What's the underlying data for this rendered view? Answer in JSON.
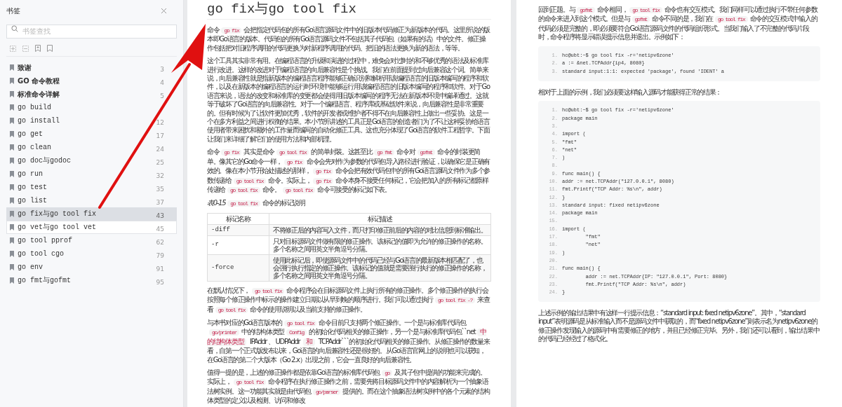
{
  "sidebar": {
    "title": "书签",
    "search": {
      "placeholder": "书签查找"
    },
    "items": [
      {
        "kind": "chapter",
        "label": "致谢",
        "page": "3",
        "selected": false,
        "hovered": false
      },
      {
        "kind": "chapter",
        "label": "GO 命令教程",
        "page": "4",
        "selected": false,
        "hovered": false
      },
      {
        "kind": "chapter",
        "label": "标准命令详解",
        "page": "5",
        "selected": false,
        "hovered": false
      },
      {
        "kind": "command",
        "label": "go build",
        "selected": false,
        "hovered": false
      },
      {
        "kind": "command",
        "label": "go install",
        "page": "12",
        "selected": false,
        "hovered": false
      },
      {
        "kind": "command",
        "label": "go get",
        "page": "17",
        "selected": false,
        "hovered": false
      },
      {
        "kind": "command",
        "label": "go clean",
        "page": "24",
        "selected": false,
        "hovered": false
      },
      {
        "kind": "command",
        "label": "go doc与godoc",
        "page": "25",
        "selected": false,
        "hovered": false
      },
      {
        "kind": "command",
        "label": "go run",
        "page": "32",
        "selected": false,
        "hovered": false
      },
      {
        "kind": "command",
        "label": "go test",
        "page": "35",
        "selected": false,
        "hovered": false
      },
      {
        "kind": "command",
        "label": "go list",
        "page": "37",
        "selected": false,
        "hovered": false
      },
      {
        "kind": "command",
        "label": "go fix与go tool fix",
        "page": "43",
        "selected": true,
        "hovered": false
      },
      {
        "kind": "command",
        "label": "go vet与go tool vet",
        "page": "45",
        "selected": false,
        "hovered": true
      },
      {
        "kind": "command",
        "label": "go tool pprof",
        "page": "62",
        "selected": false,
        "hovered": false
      },
      {
        "kind": "command",
        "label": "go tool cgo",
        "page": "79",
        "selected": false,
        "hovered": false
      },
      {
        "kind": "command",
        "label": "go env",
        "page": "91",
        "selected": false,
        "hovered": false
      },
      {
        "kind": "command",
        "label": "go fmt与gofmt",
        "page": "95",
        "selected": false,
        "hovered": false
      }
    ]
  },
  "left_page": {
    "title": "go fix与go tool fix",
    "blocks": [
      {
        "kind": "paragraph",
        "segments": [
          {
            "kind": "text",
            "text": "命令"
          },
          {
            "kind": "code",
            "text": "go fix"
          },
          {
            "kind": "text",
            "text": "会把指定代码包的所有Go语言源码文件中的旧版本代码修正为新版本的代码。这里所说的版本即Go语言的版本。代码包的所有Go语言源码文件不包括其子代码包（如果有的话）中的文件。修正操作包括把对旧程序调用的代码更换为对新程序调用的代码、把旧的语法更换为新的语法，等等。"
          }
        ]
      },
      {
        "kind": "paragraph",
        "segments": [
          {
            "kind": "text",
            "text": "这个工具其实非常有用。在编程语言的升级和演进的过程中，难免会对过时的和不够优秀的语法及标准库进行改进。这样的改进对于编程语言的向后兼容性是个挑战。我们在前面提到过向后兼容这个词。简单来说，向后兼容性就是指新版本的编程语言程序能够正确识别和解析用该编程语言的旧版本编写的程序和软件，以及在新版本的编程语言的运行时环境中能够运行用该编程语言的旧版本编写的程序和软件。对于Go语言来说，语法的改变和标准库的变更都会使得用旧版本编写的程序无法在新版本环境中编译通过。这就等于破坏了Go语言的向后兼容性。对于一个编程语言、程序库或基础软件来说，向后兼容性是非常重要的。但有时候为了让软件更加优秀，软件的开发者或维护者不得不在向后兼容性上做出一些妥协。这是一个在多方利益之间进行权衡的结果。本小节所讲述的工具正是Go语言的创造者们为了不让这种妥协给语言使用者带来困扰和额外的工作量而编写的自动化修正工具。这也充分体现了Go语言的软件工程哲学。下面让我们来详细了解它们的使用方法和内部机理。"
          }
        ]
      },
      {
        "kind": "paragraph",
        "segments": [
          {
            "kind": "text",
            "text": "命令"
          },
          {
            "kind": "code",
            "text": "go fix"
          },
          {
            "kind": "text",
            "text": "其实是命令"
          },
          {
            "kind": "code",
            "text": "go tool fix"
          },
          {
            "kind": "text",
            "text": "的简单封装。这甚至比"
          },
          {
            "kind": "code",
            "text": "go fmt"
          },
          {
            "kind": "text",
            "text": "命令对"
          },
          {
            "kind": "code",
            "text": "gofmt"
          },
          {
            "kind": "text",
            "text": "命令的封装更简单。像其它的Go命令一样，"
          },
          {
            "kind": "code",
            "text": "go fix"
          },
          {
            "kind": "text",
            "text": "命令会先对作为参数的代码包导入路径进行验证，以确保它是正确有效的。像在本小节开始处描述的那样，"
          },
          {
            "kind": "code",
            "text": "go fix"
          },
          {
            "kind": "text",
            "text": "命令会把有效代码包中的所有Go语言源码文件作为多个参数传递给"
          },
          {
            "kind": "code",
            "text": "go tool fix"
          },
          {
            "kind": "text",
            "text": "命令。实际上，"
          },
          {
            "kind": "code",
            "text": "go fix"
          },
          {
            "kind": "text",
            "text": "命令本身不接受任何标记，它会把加入的所有标记都原样传递给"
          },
          {
            "kind": "code",
            "text": "go tool fix"
          },
          {
            "kind": "text",
            "text": "命令。"
          },
          {
            "kind": "code",
            "text": "go tool fix"
          },
          {
            "kind": "text",
            "text": "命令可接受的标记如下表。"
          }
        ]
      },
      {
        "kind": "caption",
        "segments": [
          {
            "kind": "label",
            "text": "表0-15"
          },
          {
            "kind": "code",
            "text": "go tool fix"
          },
          {
            "kind": "text",
            "text": "命令的标记说明"
          }
        ]
      },
      {
        "kind": "table",
        "columns": [
          "标记名称",
          "标记描述"
        ],
        "rows": [
          [
            "-diff",
            "不将修正后的内容写入文件，而只打印修正前后的内容的对比信息到标准输出。"
          ],
          [
            "-r",
            "只对目标源码文件做有限的修正操作。该标记的值即为允许的修正操作的名称。多个名称之间用英文半角逗号分隔。"
          ],
          [
            "-force",
            "使用此标记后，即使源码文件中的代码已经与Go语言的最新版本相匹配了，也会强行执行指定的修正操作。该标记的值就是需要强行执行的修正操作的名称，多个名称之间用英文半角逗号分隔。"
          ]
        ]
      },
      {
        "kind": "paragraph",
        "segments": [
          {
            "kind": "text",
            "text": "在默认情况下，"
          },
          {
            "kind": "code",
            "text": "go tool fix"
          },
          {
            "kind": "text",
            "text": "命令程序会在目标源码文件上执行所有的修正操作。多个修正操作的执行会按照每个修正操作中标示的操作建立日期以从早到晚的顺序进行。我们可以通过执行"
          },
          {
            "kind": "code",
            "text": "go tool fix -?"
          },
          {
            "kind": "text",
            "text": "来查看"
          },
          {
            "kind": "code",
            "text": "go tool fix"
          },
          {
            "kind": "text",
            "text": "命令的使用说明以及当前支持的修正操作。"
          }
        ]
      },
      {
        "kind": "paragraph",
        "segments": [
          {
            "kind": "text",
            "text": "与本书对应的Go语言版本的"
          },
          {
            "kind": "code",
            "text": "go tool fix"
          },
          {
            "kind": "text",
            "text": "命令目前只支持两个修正操作。一个是与标准库代码包"
          },
          {
            "kind": "code",
            "text": "go/printer"
          },
          {
            "kind": "text",
            "text": "中的结构体类型"
          },
          {
            "kind": "code",
            "text": "Config"
          },
          {
            "kind": "text",
            "text": "的初始化代码相关的修正操作，另一个是与标准库代码包``net"
          },
          {
            "kind": "code",
            "text": "中的结构体类型"
          },
          {
            "kind": "text",
            "text": " IPAddr 、 UDPAddr "
          },
          {
            "kind": "code",
            "text": "和"
          },
          {
            "kind": "text",
            "text": " TCPAddr```的初始化代码相关的修正操作。从修正操作的数量来看，自第一个正式版发布以来，Go语言的向后兼容性还是很好的。从Go语言官网上的说明也可以获知，在Go语言的第二个大版本（Go 2.x）出现之前，它会一直良好的向后兼容性。"
          }
        ]
      },
      {
        "kind": "paragraph",
        "segments": [
          {
            "kind": "text",
            "text": "值得一提的是，上述的修正操作都是依靠Go语言的标准库代码包"
          },
          {
            "kind": "code",
            "text": "go"
          },
          {
            "kind": "text",
            "text": "及其子包中提供的功能来完成的。实际上，"
          },
          {
            "kind": "code",
            "text": "go tool fix"
          },
          {
            "kind": "text",
            "text": "命令程序在执行修正操作之前，需要先将目标源码文件中的内容解析为一个抽象语法树实例。这一功能其实就是由代码包"
          },
          {
            "kind": "code",
            "text": "go/parser"
          },
          {
            "kind": "text",
            "text": "提供的。而在这个抽象语法树实例中的各个元素的结构体类型的定义以及检测、访问和修改"
          }
        ]
      }
    ]
  },
  "right_page": {
    "blocks": [
      {
        "kind": "paragraph",
        "segments": [
          {
            "kind": "text",
            "text": "回到正题。与"
          },
          {
            "kind": "code",
            "text": "gofmt"
          },
          {
            "kind": "text",
            "text": "命令相同，"
          },
          {
            "kind": "code",
            "text": "go tool fix"
          },
          {
            "kind": "text",
            "text": "命令也有交互模式。我们同样可以通过执行不带任何参数的命令来进入到这个模式。但是与"
          },
          {
            "kind": "code",
            "text": "gofmt"
          },
          {
            "kind": "text",
            "text": "命令不同的是，我们在"
          },
          {
            "kind": "code",
            "text": "go tool fix"
          },
          {
            "kind": "text",
            "text": "命令的交互模式中输入的代码必须是完整的，即必须要符合Go语言源码文件的代码组织形式。当我们输入了不完整的代码片段时，命令程序将显示错误提示信息并退出。示例如下："
          }
        ]
      },
      {
        "kind": "code",
        "lines": [
          {
            "n": "1.",
            "code": "hc@ubt:~$ go tool fix -r='netipv6zone'"
          },
          {
            "n": "2.",
            "code": "a := &net.TCPAddr{ip4, 8080}"
          },
          {
            "n": "3.",
            "code": "standard input:1:1: expected 'package', found 'IDENT' a"
          }
        ]
      },
      {
        "kind": "paragraph",
        "segments": [
          {
            "kind": "text",
            "text": "相对于上面的示例，我们必须要这样输入源码才能获得正常的结果："
          }
        ]
      },
      {
        "kind": "code",
        "lines": [
          {
            "n": "1.",
            "code": "hc@ubt:~$ go tool fix -r='netipv6zone'"
          },
          {
            "n": "2.",
            "code": "package main"
          },
          {
            "n": "3."
          },
          {
            "n": "4.",
            "code": "import ("
          },
          {
            "n": "5.",
            "code": "\"fmt\""
          },
          {
            "n": "6.",
            "code": "\"net\""
          },
          {
            "n": "7.",
            "code": ")"
          },
          {
            "n": "8."
          },
          {
            "n": "9.",
            "code": "func main() {"
          },
          {
            "n": "10.",
            "code": "addr := net.TCPAddr(\"127.0.0.1\", 8080)"
          },
          {
            "n": "11.",
            "code": "fmt.Printf(\"TCP Addr: %s\\n\", addr)"
          },
          {
            "n": "12.",
            "code": "}"
          },
          {
            "n": "13.",
            "code": "standard input: fixed netipv6zone"
          },
          {
            "n": "14.",
            "code": "package main"
          },
          {
            "n": "15."
          },
          {
            "n": "16.",
            "code": "import ("
          },
          {
            "n": "17.",
            "code": "        \"fmt\""
          },
          {
            "n": "18.",
            "code": "        \"net\""
          },
          {
            "n": "19.",
            "code": ")"
          },
          {
            "n": "20."
          },
          {
            "n": "21.",
            "code": "func main() {"
          },
          {
            "n": "22.",
            "code": "        addr := net.TCPAddr{IP: \"127.0.0.1\", Port: 8080}"
          },
          {
            "n": "23.",
            "code": "        fmt.Printf(\"TCP Addr: %s\\n\", addr)"
          },
          {
            "n": "24.",
            "code": "}"
          }
        ]
      },
      {
        "kind": "paragraph",
        "segments": [
          {
            "kind": "text",
            "text": "上述示例的输出结果中有这样一行提示信息：“standard input: fixed netipv6zone”。其中，“standard input”表明源码是从标准输入而不是源码文件中获取的，而“fixed netipv6zone”则表示名为netipv6zone的修正操作发现输入的源码中有需要修正的地方，并且已经修正完毕。另外，我们还可以看到，输出结果中的代码已经经过了格式化。"
          }
        ]
      }
    ]
  }
}
